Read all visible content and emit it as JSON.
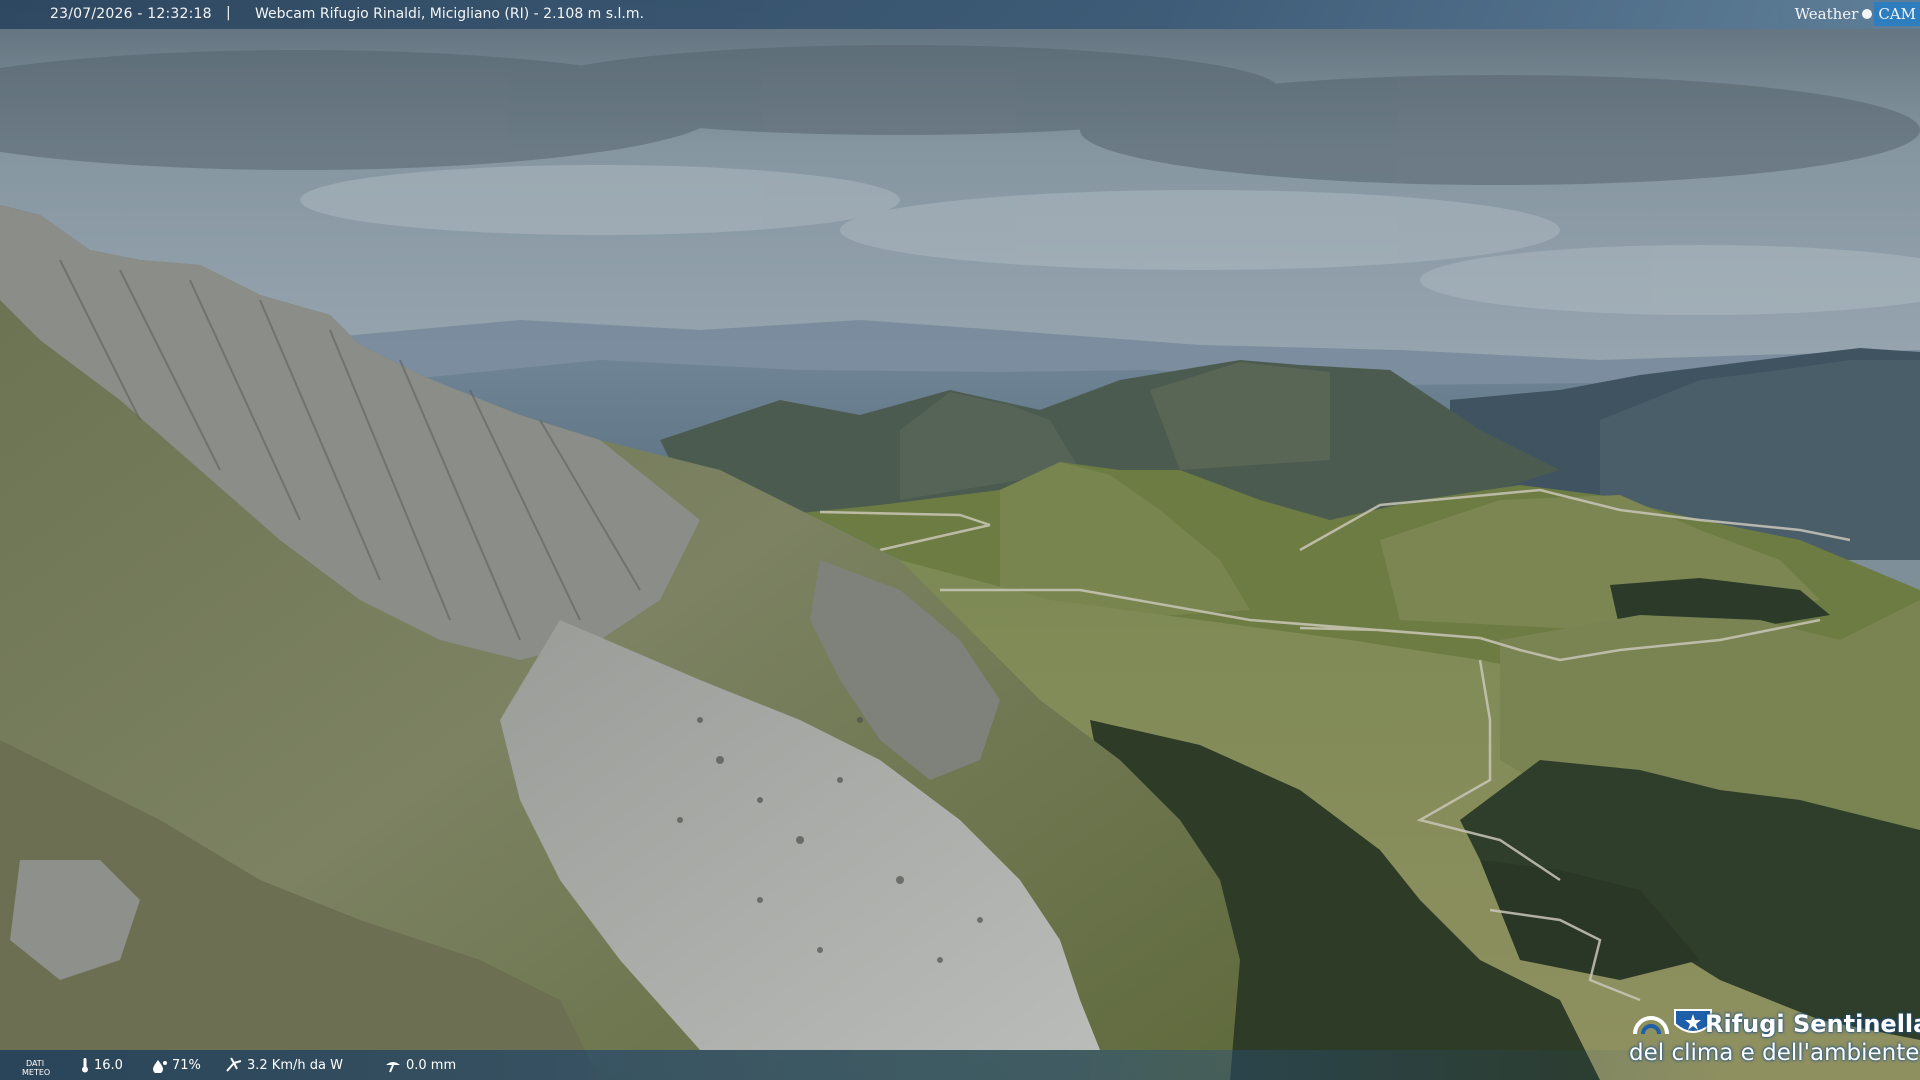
{
  "overlay": {
    "timestamp": "23/07/2026 - 12:32:18",
    "separator": "|",
    "title": "Webcam Rifugio Rinaldi, Micigliano (RI) - 2.108 m s.l.m.",
    "brand_weather": "Weather",
    "brand_cam": "CAM"
  },
  "meteo": {
    "label": "DATI METEO",
    "temperature": "16.0",
    "humidity": "71%",
    "wind": "3.2 Km/h da W",
    "rain": "0.0 mm"
  },
  "logo": {
    "line1": "Rifugi Sentinella",
    "line2": "del clima e dell'ambiente"
  },
  "colors": {
    "sky": "#7d8f9b",
    "bar": "#2c4660",
    "brand_blue": "#2b7fc4",
    "grass": "#6b7a45",
    "rock": "#8a8c86",
    "forest": "#2d3b27"
  }
}
